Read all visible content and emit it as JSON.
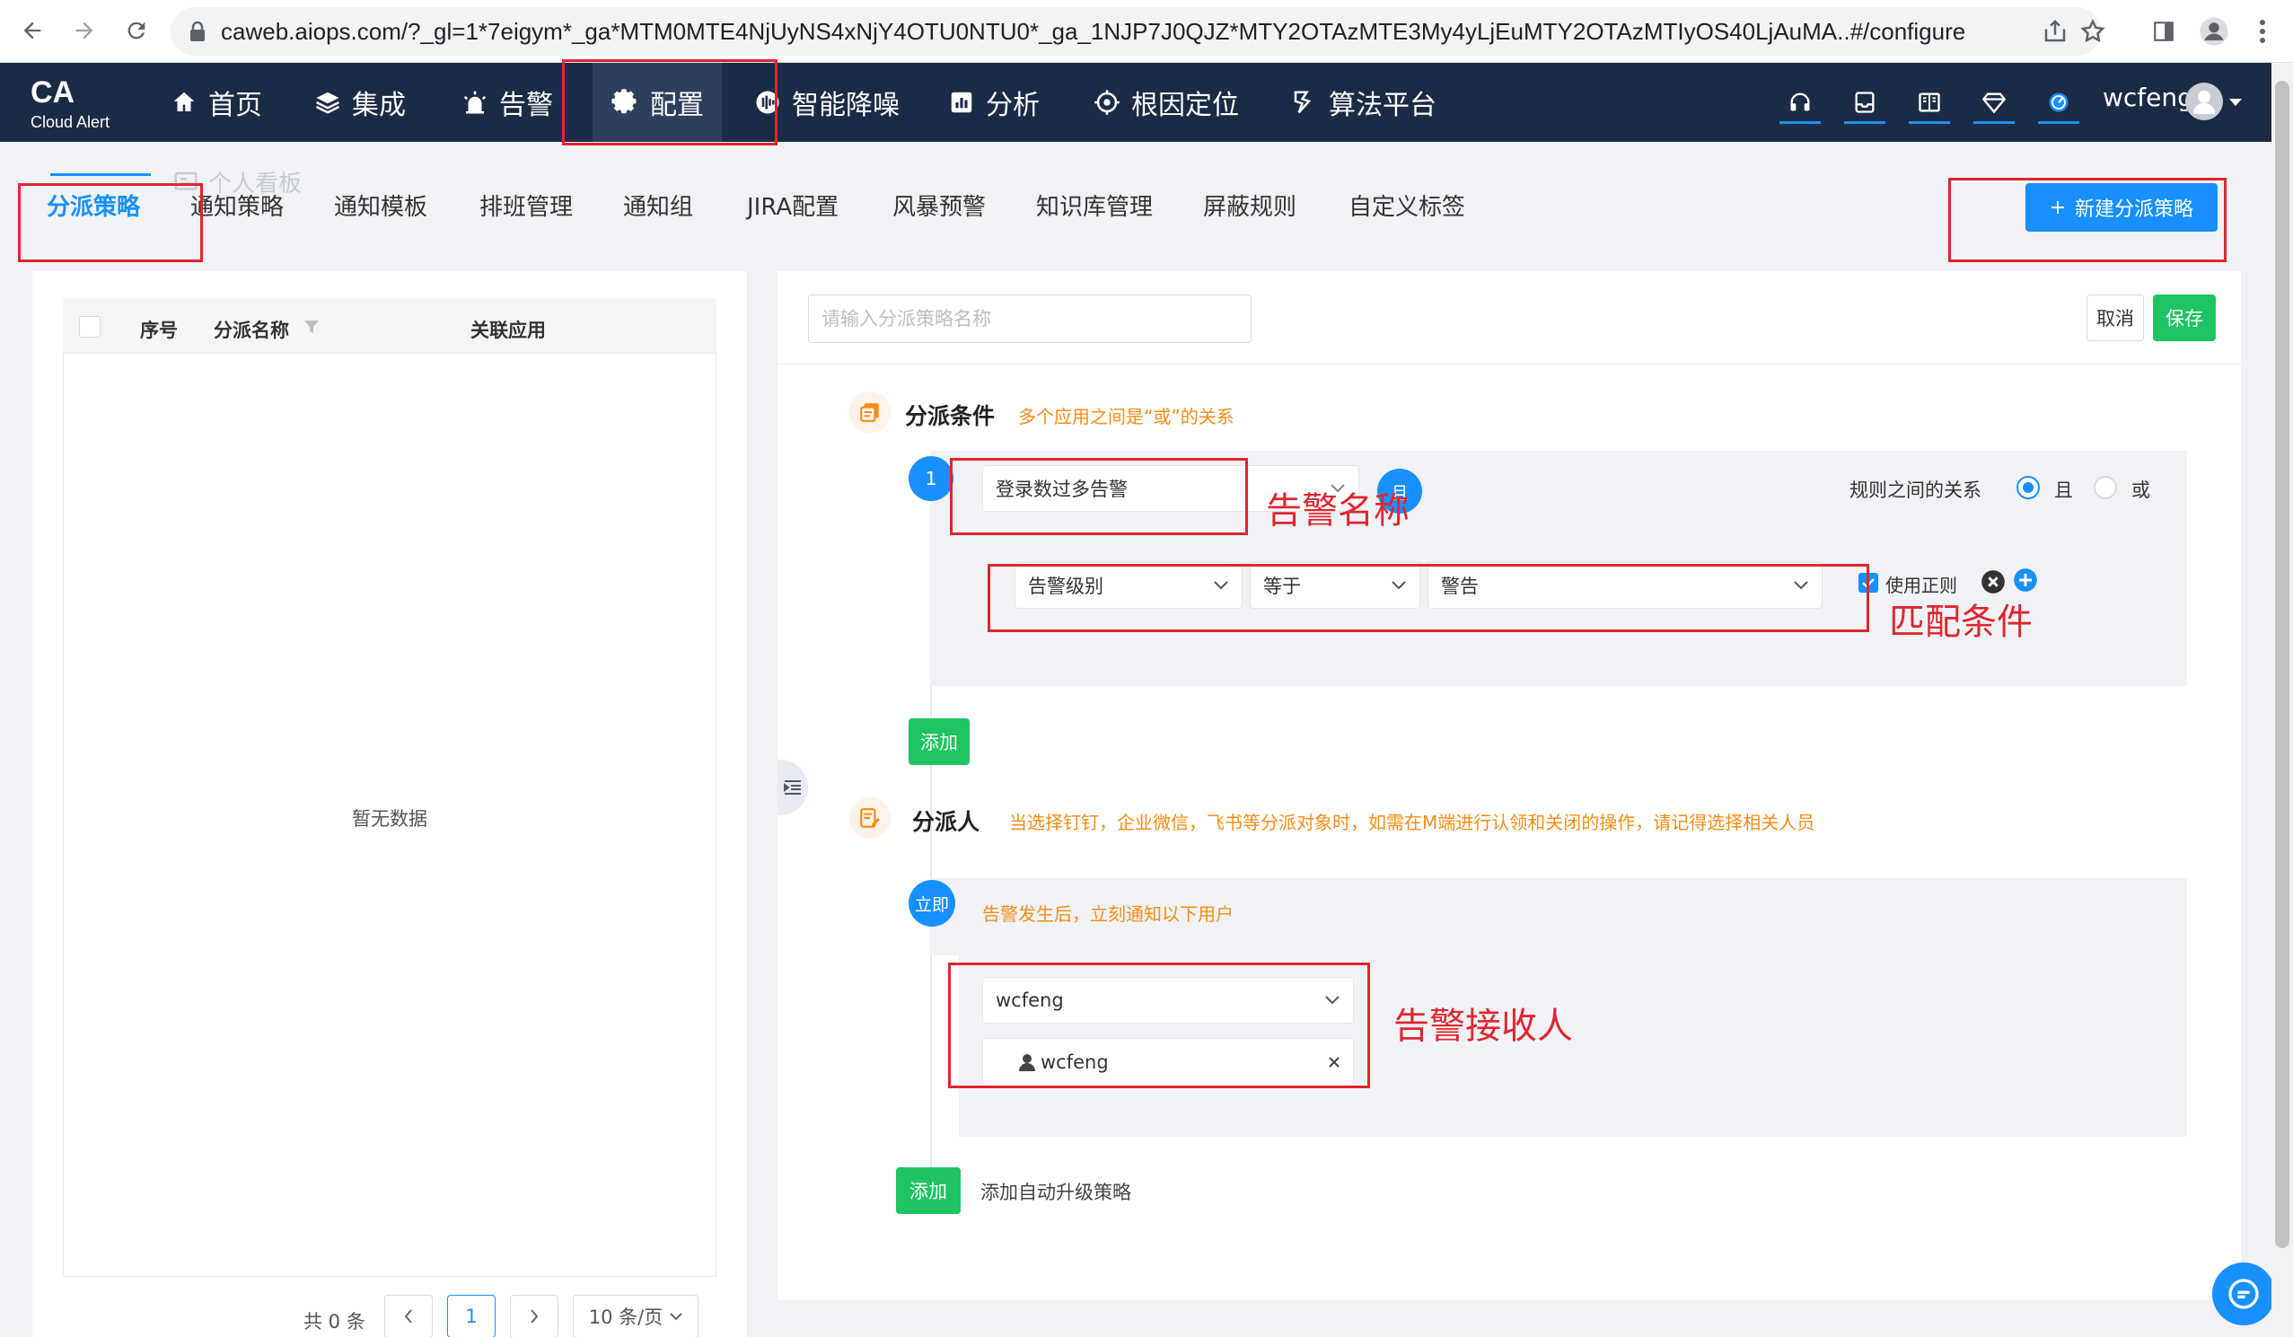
{
  "browser": {
    "url": "caweb.aiops.com/?_gl=1*7eigym*_ga*MTM0MTE4NjUyNS4xNjY4OTU0NTU0*_ga_1NJP7J0QJZ*MTY2OTAzMTE3My4yLjEuMTY2OTAzMTIyOS40LjAuMA..#/configure"
  },
  "brand": {
    "logo": "CA",
    "sub": "Cloud Alert"
  },
  "menu": [
    {
      "label": "首页",
      "icon": "home-icon"
    },
    {
      "label": "集成",
      "icon": "layers-icon"
    },
    {
      "label": "告警",
      "icon": "alarm-icon"
    },
    {
      "label": "配置",
      "icon": "gear-icon",
      "active": true
    },
    {
      "label": "智能降噪",
      "icon": "noise-icon"
    },
    {
      "label": "分析",
      "icon": "chart-icon"
    },
    {
      "label": "根因定位",
      "icon": "target-icon"
    },
    {
      "label": "算法平台",
      "icon": "algorithm-icon"
    }
  ],
  "user": {
    "name": "wcfeng"
  },
  "ghost_tab": "个人看板",
  "tabs": [
    "分派策略",
    "通知策略",
    "通知模板",
    "排班管理",
    "通知组",
    "JIRA配置",
    "风暴预警",
    "知识库管理",
    "屏蔽规则",
    "自定义标签"
  ],
  "new_button": "新建分派策略",
  "list": {
    "columns": {
      "index": "序号",
      "name": "分派名称",
      "app": "关联应用"
    },
    "empty": "暂无数据",
    "total": "共 0 条",
    "page": "1",
    "page_size": "10 条/页"
  },
  "form": {
    "search_placeholder": "请输入分派策略名称",
    "cancel": "取消",
    "save": "保存",
    "condition": {
      "title": "分派条件",
      "hint": "多个应用之间是“或”的关系",
      "rule_index": "1",
      "alert_name": "登录数过多告警",
      "and_badge": "且",
      "relation_label": "规则之间的关系",
      "relation_and": "且",
      "relation_or": "或",
      "field": "告警级别",
      "operator": "等于",
      "value": "警告",
      "regex": "使用正则",
      "add": "添加"
    },
    "assignee": {
      "title": "分派人",
      "hint": "当选择钉钉，企业微信，飞书等分派对象时，如需在M端进行认领和关闭的操作，请记得选择相关人员",
      "badge": "立即",
      "desc": "告警发生后，立刻通知以下用户",
      "select": "wcfeng",
      "tag": "wcfeng",
      "add": "添加",
      "add_escalation": "添加自动升级策略"
    }
  },
  "annotations": {
    "alert_name": "告警名称",
    "match": "匹配条件",
    "receiver": "告警接收人"
  }
}
